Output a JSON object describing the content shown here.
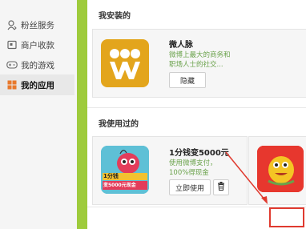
{
  "sidebar": {
    "items": [
      {
        "label": "粉丝服务",
        "icon": "person-icon"
      },
      {
        "label": "商户收款",
        "icon": "receipt-icon"
      },
      {
        "label": "我的游戏",
        "icon": "gamepad-icon"
      },
      {
        "label": "我的应用",
        "icon": "apps-icon",
        "active": true
      }
    ]
  },
  "main": {
    "installed": {
      "title": "我安装的",
      "app": {
        "name": "微人脉",
        "desc_line1": "微博上最大的商务和",
        "desc_line2": "职场人士的社交...",
        "button": "隐藏"
      }
    },
    "used": {
      "title": "我使用过的",
      "app": {
        "name": "1分钱变5000元",
        "desc_line1": "使用微博支付，",
        "desc_line2": "100%得现金",
        "button": "立即使用",
        "delete_icon": "trash-icon",
        "icon_text_top": "1分钱",
        "icon_text_bottom": "变5000元现金"
      }
    }
  },
  "colors": {
    "accent_green": "#9ecb3c",
    "desc_green": "#6aa24b",
    "annotation_red": "#e03a2f",
    "weirenmai_gold": "#e3a51c"
  }
}
